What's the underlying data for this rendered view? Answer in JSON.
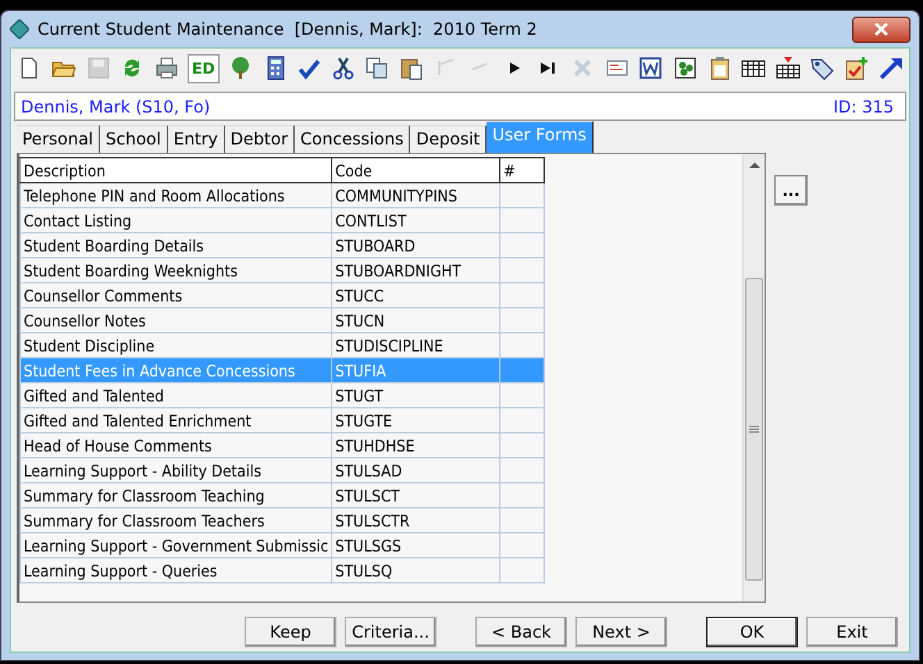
{
  "window": {
    "title": "Current Student Maintenance  [Dennis, Mark]:  2010 Term 2"
  },
  "toolbar": [
    {
      "kind": "new",
      "disabled": false
    },
    {
      "kind": "open",
      "disabled": false
    },
    {
      "kind": "save",
      "disabled": true
    },
    {
      "kind": "refresh",
      "disabled": false
    },
    {
      "kind": "print",
      "disabled": false
    },
    {
      "kind": "text",
      "label": "ED",
      "disabled": false
    },
    {
      "kind": "tree",
      "disabled": false
    },
    {
      "kind": "calculator",
      "disabled": false
    },
    {
      "kind": "spell",
      "disabled": false
    },
    {
      "kind": "cut",
      "disabled": false
    },
    {
      "kind": "copy",
      "disabled": false
    },
    {
      "kind": "paste",
      "disabled": false
    },
    {
      "kind": "first",
      "disabled": true
    },
    {
      "kind": "line",
      "disabled": true
    },
    {
      "kind": "play",
      "disabled": false
    },
    {
      "kind": "last",
      "disabled": false
    },
    {
      "kind": "delete",
      "disabled": true
    },
    {
      "kind": "card",
      "disabled": false
    },
    {
      "kind": "word",
      "disabled": false
    },
    {
      "kind": "dots",
      "disabled": false
    },
    {
      "kind": "clipboard",
      "disabled": false
    },
    {
      "kind": "table",
      "disabled": false
    },
    {
      "kind": "tablepin",
      "disabled": false
    },
    {
      "kind": "tag",
      "disabled": false
    },
    {
      "kind": "checkadd",
      "disabled": false
    },
    {
      "kind": "arrow",
      "disabled": false
    }
  ],
  "student": {
    "name": "Dennis, Mark (S10, Fo)",
    "id": "ID: 315"
  },
  "tabs": [
    {
      "label": "Personal",
      "selected": false
    },
    {
      "label": "School",
      "selected": false
    },
    {
      "label": "Entry",
      "selected": false
    },
    {
      "label": "Debtor",
      "selected": false
    },
    {
      "label": "Concessions",
      "selected": false
    },
    {
      "label": "Deposit",
      "selected": false
    },
    {
      "label": "User Forms",
      "selected": true
    }
  ],
  "table": {
    "columns": [
      "Description",
      "Code",
      "#"
    ],
    "rows": [
      {
        "cells": [
          "Telephone PIN and Room Allocations",
          "COMMUNITYPINS",
          ""
        ],
        "selected": false
      },
      {
        "cells": [
          "Contact Listing",
          "CONTLIST",
          ""
        ],
        "selected": false
      },
      {
        "cells": [
          "Student Boarding Details",
          "STUBOARD",
          ""
        ],
        "selected": false
      },
      {
        "cells": [
          "Student Boarding Weeknights",
          "STUBOARDNIGHT",
          ""
        ],
        "selected": false
      },
      {
        "cells": [
          "Counsellor Comments",
          "STUCC",
          ""
        ],
        "selected": false
      },
      {
        "cells": [
          "Counsellor Notes",
          "STUCN",
          ""
        ],
        "selected": false
      },
      {
        "cells": [
          "Student Discipline",
          "STUDISCIPLINE",
          ""
        ],
        "selected": false
      },
      {
        "cells": [
          "Student Fees in Advance Concessions",
          "STUFIA",
          ""
        ],
        "selected": true
      },
      {
        "cells": [
          "Gifted and Talented",
          "STUGT",
          ""
        ],
        "selected": false
      },
      {
        "cells": [
          "Gifted and Talented Enrichment",
          "STUGTE",
          ""
        ],
        "selected": false
      },
      {
        "cells": [
          "Head of House Comments",
          "STUHDHSE",
          ""
        ],
        "selected": false
      },
      {
        "cells": [
          "Learning Support - Ability Details",
          "STULSAD",
          ""
        ],
        "selected": false
      },
      {
        "cells": [
          "Summary for Classroom Teaching",
          "STULSCT",
          ""
        ],
        "selected": false
      },
      {
        "cells": [
          "Summary for Classroom Teachers",
          "STULSCTR",
          ""
        ],
        "selected": false
      },
      {
        "cells": [
          "Learning Support - Government Submissic",
          "STULSGS",
          ""
        ],
        "selected": false
      },
      {
        "cells": [
          "Learning Support - Queries",
          "STULSQ",
          ""
        ],
        "selected": false
      }
    ]
  },
  "side_button": "...",
  "buttons": [
    {
      "label": "Keep",
      "default": false
    },
    {
      "label": "Criteria...",
      "default": false
    },
    {
      "label": "< Back",
      "default": false
    },
    {
      "label": "Next >",
      "default": false
    },
    {
      "label": "OK",
      "default": true
    },
    {
      "label": "Exit",
      "default": false
    }
  ]
}
